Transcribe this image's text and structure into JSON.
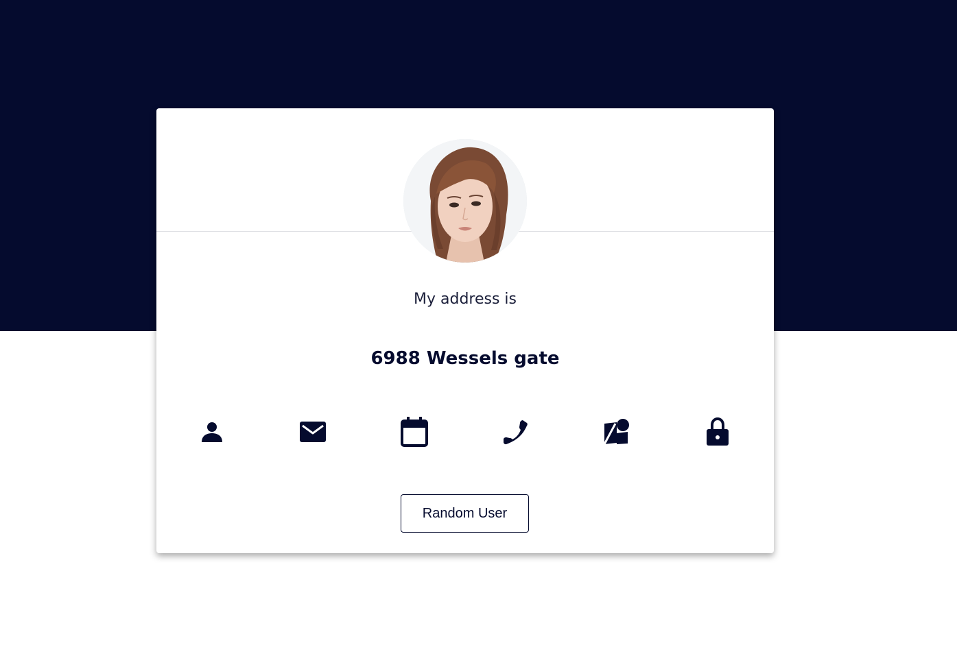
{
  "card": {
    "label": "My address is",
    "value": "6988 Wessels gate",
    "button_label": "Random User"
  },
  "icons": [
    {
      "name": "user-icon"
    },
    {
      "name": "email-icon"
    },
    {
      "name": "calendar-icon"
    },
    {
      "name": "phone-icon"
    },
    {
      "name": "map-icon"
    },
    {
      "name": "lock-icon"
    }
  ],
  "colors": {
    "header_bg": "#050b2e",
    "icon": "#050b2e",
    "text": "#1b1f3a"
  }
}
